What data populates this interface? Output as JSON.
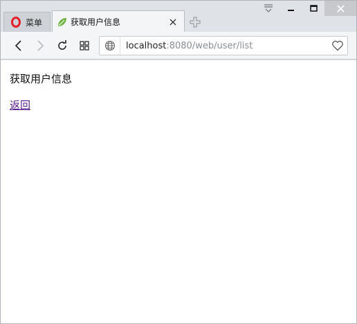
{
  "tabs": {
    "menu_label": "菜单",
    "active_title": "获取用户信息"
  },
  "addressbar": {
    "host": "localhost",
    "rest": ":8080/web/user/list"
  },
  "page": {
    "heading": "获取用户信息",
    "back_link": "返回"
  },
  "colors": {
    "opera_red": "#e3202a",
    "spring_green": "#6db33f",
    "link_visited": "#551a8b"
  },
  "icons": [
    "opera-logo-icon",
    "spring-leaf-icon",
    "close-icon",
    "new-tab-icon",
    "stash-icon",
    "minimize-icon",
    "maximize-icon",
    "window-close-icon",
    "back-icon",
    "forward-icon",
    "reload-icon",
    "speed-dial-icon",
    "globe-icon",
    "heart-icon"
  ]
}
